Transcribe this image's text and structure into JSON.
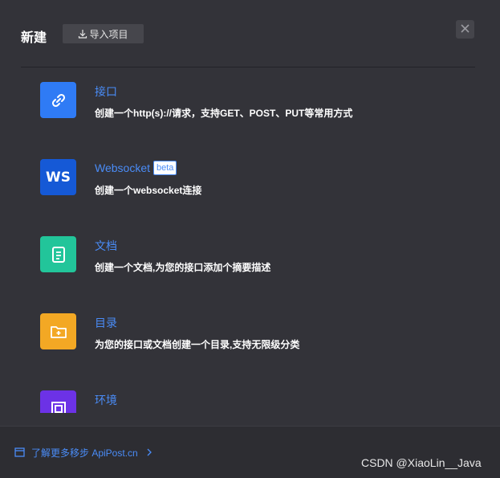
{
  "header": {
    "title": "新建",
    "import_label": "导入项目"
  },
  "items": [
    {
      "name": "接口",
      "desc": "创建一个http(s)://请求，支持GET、POST、PUT等常用方式",
      "color": "#2f7bf5",
      "icon": "link-icon"
    },
    {
      "name": "Websocket",
      "badge": "beta",
      "desc": "创建一个websocket连接",
      "color": "#1559d6",
      "icon_text": "WS",
      "icon": "websocket-icon"
    },
    {
      "name": "文档",
      "desc": "创建一个文档,为您的接口添加个摘要描述",
      "color": "#22c59a",
      "icon": "document-icon"
    },
    {
      "name": "目录",
      "desc": "为您的接口或文档创建一个目录,支持无限级分类",
      "color": "#f3a824",
      "icon": "folder-plus-icon"
    },
    {
      "name": "环境",
      "color": "#6c32e6",
      "icon": "environment-icon"
    }
  ],
  "footer": {
    "link_label": "了解更多移步 ApiPost.cn"
  },
  "watermark": "CSDN @XiaoLin__Java"
}
